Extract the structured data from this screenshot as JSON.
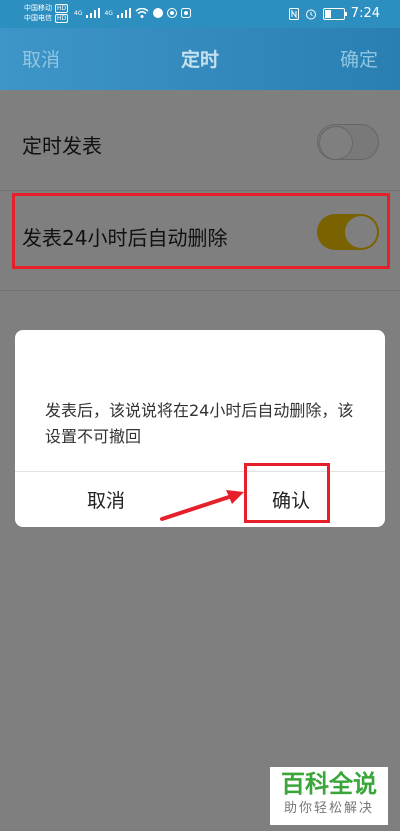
{
  "status_bar": {
    "carrier1": "中国移动",
    "carrier2": "中国电信",
    "hd": "HD",
    "net1": "4G",
    "net2": "4G",
    "time": "7:24"
  },
  "header": {
    "cancel_label": "取消",
    "title": "定时",
    "confirm_label": "确定"
  },
  "settings": [
    {
      "label": "定时发表",
      "enabled": false
    },
    {
      "label": "发表24小时后自动删除",
      "enabled": true
    }
  ],
  "dialog": {
    "message": "发表后，该说说将在24小时后自动删除，该设置不可撤回",
    "cancel_label": "取消",
    "confirm_label": "确认"
  },
  "colors": {
    "header": "#2d8ec0",
    "toggle_on": "#f4c400",
    "highlight": "#e5202a",
    "watermark_green": "#3aa539"
  },
  "watermark": {
    "title": "百科全说",
    "subtitle": "助你轻松解决"
  }
}
